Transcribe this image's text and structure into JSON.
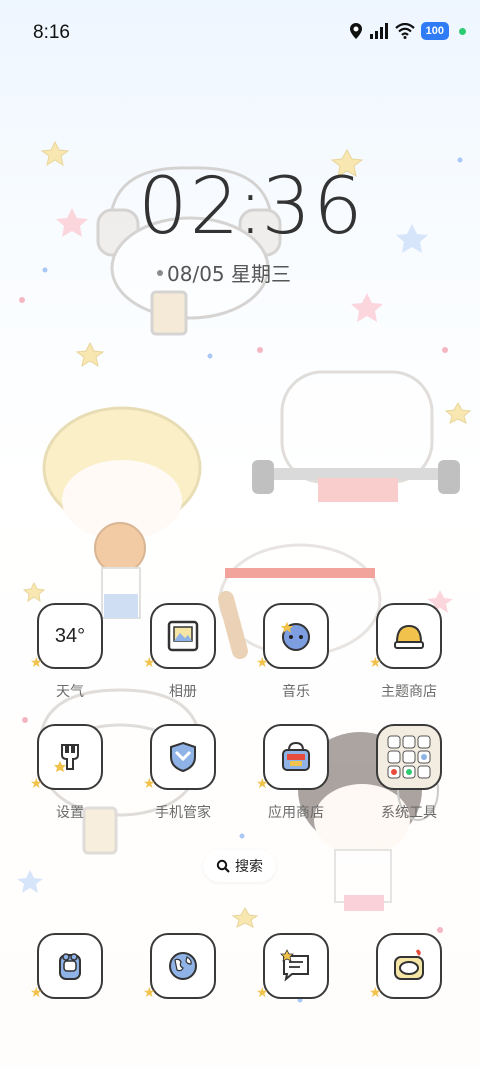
{
  "status_bar": {
    "time": "8:16",
    "battery": "100",
    "icons": [
      "location-icon",
      "signal-icon",
      "wifi-icon",
      "battery-icon",
      "active-dot-icon"
    ]
  },
  "clock": {
    "hours": "02",
    "minutes": "36"
  },
  "date": {
    "text": "08/05 星期三"
  },
  "apps_row1": [
    {
      "label": "天气",
      "icon": "weather-icon",
      "temp": "34°"
    },
    {
      "label": "相册",
      "icon": "gallery-icon"
    },
    {
      "label": "音乐",
      "icon": "music-icon"
    },
    {
      "label": "主题商店",
      "icon": "theme-store-icon"
    }
  ],
  "apps_row2": [
    {
      "label": "设置",
      "icon": "settings-icon"
    },
    {
      "label": "手机管家",
      "icon": "security-icon"
    },
    {
      "label": "应用商店",
      "icon": "app-store-icon"
    },
    {
      "label": "系统工具",
      "icon": "system-tools-folder-icon"
    }
  ],
  "search": {
    "label": "搜索"
  },
  "dock": [
    {
      "icon": "phone-icon"
    },
    {
      "icon": "browser-icon"
    },
    {
      "icon": "messages-icon"
    },
    {
      "icon": "camera-icon"
    }
  ],
  "colors": {
    "accent": "#2f7cf6",
    "star": "#f2c34c",
    "outline": "#3a3a3a"
  }
}
